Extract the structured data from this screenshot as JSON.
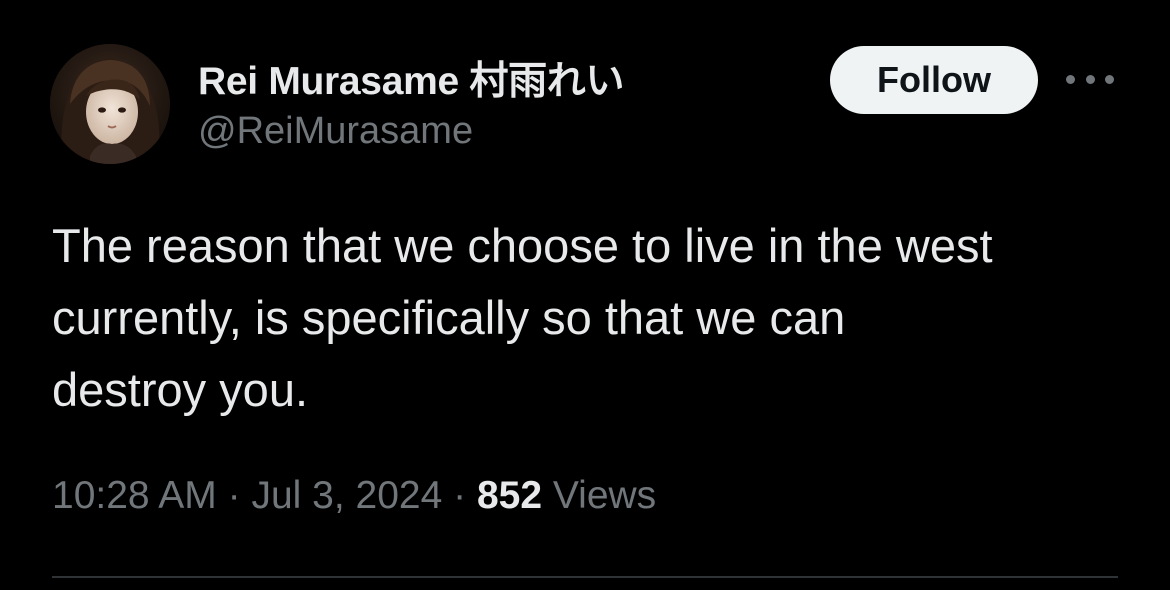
{
  "author": {
    "display_name": "Rei Murasame 村雨れい",
    "handle": "@ReiMurasame",
    "avatar": "profile-photo"
  },
  "actions": {
    "follow_label": "Follow",
    "more_icon": "more-horizontal-icon"
  },
  "tweet": {
    "text_lines": [
      "The reason that we choose to live in the west",
      "currently, is specifically so that we can",
      "destroy you."
    ],
    "time": "10:28 AM",
    "date": "Jul 3, 2024",
    "separator": " · ",
    "views_count": "852",
    "views_label": "Views"
  },
  "colors": {
    "background": "#000000",
    "primary_text": "#e7e9ea",
    "secondary_text": "#71767b",
    "follow_bg": "#eff3f4",
    "divider": "#2f3336"
  }
}
